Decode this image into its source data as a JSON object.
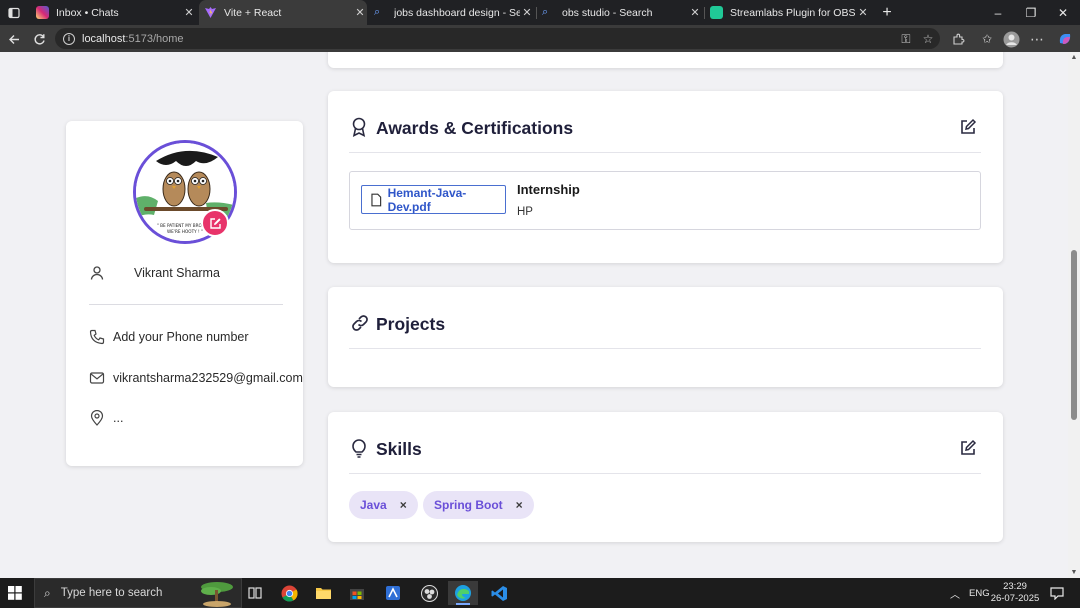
{
  "browser": {
    "tabs": [
      {
        "title": "Inbox • Chats",
        "favicon_color": "#d6249f",
        "active": false
      },
      {
        "title": "Vite + React",
        "favicon_color": "#9b59ff",
        "active": true
      },
      {
        "title": "jobs dashboard design - Search",
        "favicon_color": "#3b82f6",
        "active": false
      },
      {
        "title": "obs studio - Search",
        "favicon_color": "#3b82f6",
        "active": false
      },
      {
        "title": "Streamlabs Plugin for OBS | Add a",
        "favicon_color": "#20c997",
        "active": false
      }
    ],
    "new_tab_label": "+",
    "url_host": "localhost",
    "url_rest": ":5173/home",
    "win_controls": {
      "minimize": "–",
      "restore": "❐",
      "close": "✕"
    }
  },
  "profile": {
    "name": "Vikrant Sharma",
    "phone": "Add your Phone number",
    "email": "vikrantsharma232529@gmail.com",
    "location": "...",
    "avatar_caption": "\" BE PATIENT MY BROTHER WE'RE HOOTY !\""
  },
  "awards": {
    "title": "Awards & Certifications",
    "items": [
      {
        "file": "Hemant-Java-Dev.pdf",
        "title": "Internship",
        "org": "HP"
      }
    ]
  },
  "projects": {
    "title": "Projects"
  },
  "skills": {
    "title": "Skills",
    "items": [
      {
        "label": "Java",
        "remove": "×"
      },
      {
        "label": "Spring Boot",
        "remove": "×"
      }
    ]
  },
  "taskbar": {
    "search_placeholder": "Type here to search",
    "language": "ENG",
    "time": "23:29",
    "date": "26-07-2025"
  },
  "colors": {
    "accent_purple": "#6a4fd8",
    "edit_pink": "#e8336a",
    "link_blue": "#2f56c9",
    "page_bg": "#f1f1f4"
  }
}
